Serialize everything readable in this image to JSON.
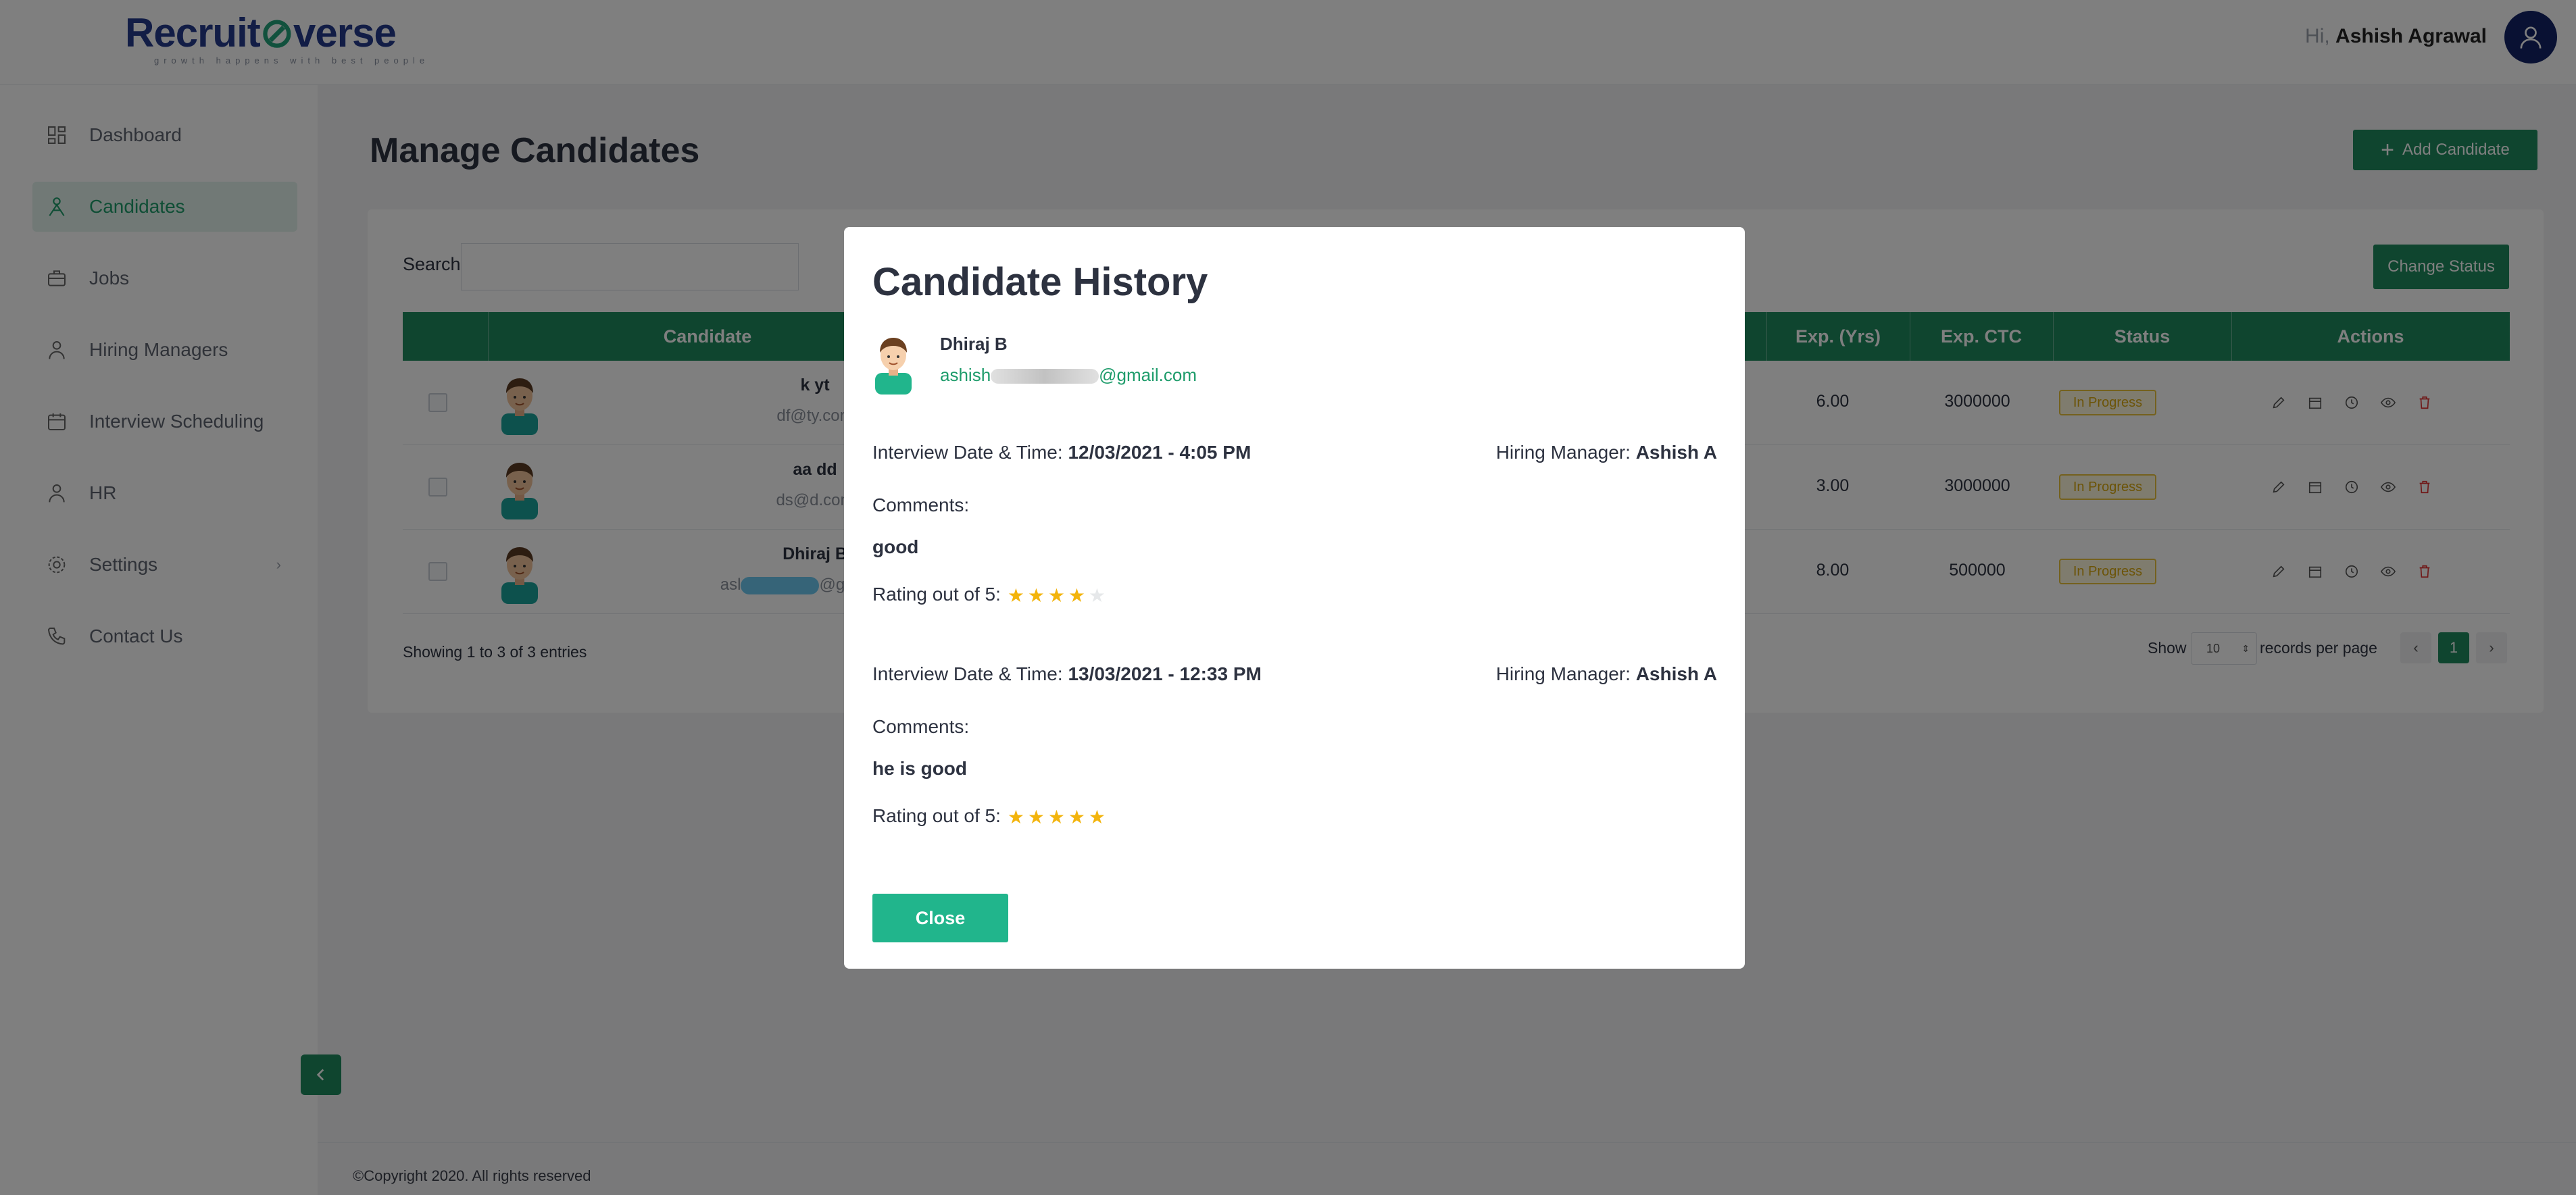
{
  "header": {
    "logo_part1": "Recruit",
    "logo_part2": "verse",
    "tagline": "growth happens with best people",
    "greeting_prefix": "Hi,",
    "user_name": "Ashish Agrawal"
  },
  "sidebar": {
    "items": [
      {
        "label": "Dashboard",
        "icon": "dashboard-icon"
      },
      {
        "label": "Candidates",
        "icon": "candidates-icon",
        "active": true
      },
      {
        "label": "Jobs",
        "icon": "briefcase-icon"
      },
      {
        "label": "Hiring Managers",
        "icon": "person-icon"
      },
      {
        "label": "Interview Scheduling",
        "icon": "calendar-icon"
      },
      {
        "label": "HR",
        "icon": "person-icon"
      },
      {
        "label": "Settings",
        "icon": "gear-icon"
      },
      {
        "label": "Contact Us",
        "icon": "phone-icon"
      }
    ]
  },
  "main": {
    "title": "Manage Candidates",
    "add_button": "Add Candidate",
    "search_label": "Search",
    "change_status_button": "Change Status",
    "columns": [
      "Candidate",
      "Exp. (Yrs)",
      "Exp. CTC",
      "Status",
      "Actions"
    ],
    "rows": [
      {
        "name": "k yt",
        "email": "df@ty.com",
        "exp": "6.00",
        "ctc": "3000000",
        "status": "In Progress"
      },
      {
        "name": "aa dd",
        "email": "ds@d.com",
        "exp": "3.00",
        "ctc": "3000000",
        "status": "In Progress"
      },
      {
        "name": "Dhiraj B",
        "email_prefix": "asl",
        "email_suffix": "@gmail.com",
        "exp": "8.00",
        "ctc": "500000",
        "status": "In Progress"
      }
    ],
    "showing": "Showing 1 to 3 of 3 entries",
    "show_label": "Show",
    "records_per_page_value": "10",
    "records_per_page_label": "records per page",
    "current_page": "1"
  },
  "footer": {
    "copyright": "©Copyright 2020. All rights reserved"
  },
  "modal": {
    "title": "Candidate History",
    "candidate_name": "Dhiraj B",
    "candidate_email_visible": "ashish",
    "candidate_email_suffix": "@gmail.com",
    "entries": [
      {
        "datetime_label": "Interview Date & Time:",
        "datetime": "12/03/2021 - 4:05 PM",
        "manager_label": "Hiring Manager:",
        "manager": "Ashish A",
        "comments_label": "Comments:",
        "comment": "good",
        "rating_label": "Rating out of 5:",
        "rating": 4
      },
      {
        "datetime_label": "Interview Date & Time:",
        "datetime": "13/03/2021 - 12:33 PM",
        "manager_label": "Hiring Manager:",
        "manager": "Ashish A",
        "comments_label": "Comments:",
        "comment": "he is good",
        "rating_label": "Rating out of 5:",
        "rating": 5
      }
    ],
    "close_button": "Close"
  },
  "colors": {
    "brand_green": "#1e8a5f",
    "accent_teal": "#21b58c",
    "brand_navy": "#243b8c",
    "star": "#f3b40c"
  }
}
